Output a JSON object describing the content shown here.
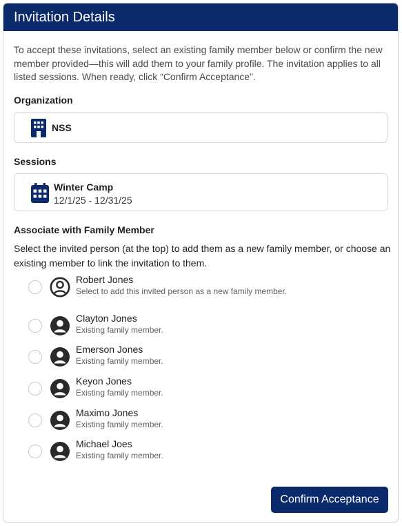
{
  "header": {
    "title": "Invitation Details"
  },
  "intro": "To accept these invitations, select an existing family member below or confirm the new member provided—this will add them to your family profile. The invitation applies to all listed sessions. When ready, click “Confirm Acceptance”.",
  "organization": {
    "label": "Organization",
    "name": "NSS",
    "icon": "building-icon"
  },
  "sessions": {
    "label": "Sessions",
    "items": [
      {
        "name": "Winter Camp",
        "dates": "12/1/25 - 12/31/25",
        "icon": "calendar-icon"
      }
    ]
  },
  "associate": {
    "label": "Associate with Family Member",
    "instructions": "Select the invited person (at the top) to add them as a new family member, or choose an existing member to link the invitation to them.",
    "members": [
      {
        "name": "Robert Jones",
        "subtitle": "Select to add this invited person as a new family member.",
        "icon": "user-circle-outline-icon"
      },
      {
        "name": "Clayton Jones",
        "subtitle": "Existing family member.",
        "icon": "user-circle-icon"
      },
      {
        "name": "Emerson Jones",
        "subtitle": "Existing family member.",
        "icon": "user-circle-icon"
      },
      {
        "name": "Keyon Jones",
        "subtitle": "Existing family member.",
        "icon": "user-circle-icon"
      },
      {
        "name": "Maximo Jones",
        "subtitle": "Existing family member.",
        "icon": "user-circle-icon"
      },
      {
        "name": "Michael Joes",
        "subtitle": "Existing family member.",
        "icon": "user-circle-icon"
      }
    ]
  },
  "actions": {
    "confirm_label": "Confirm Acceptance"
  },
  "colors": {
    "brand": "#0b2a6b",
    "border": "#d4d4d4"
  }
}
